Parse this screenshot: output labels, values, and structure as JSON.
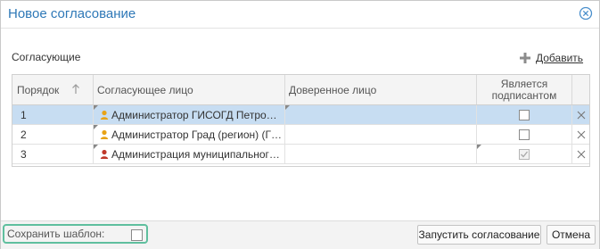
{
  "dialog": {
    "title": "Новое согласование"
  },
  "section": {
    "label": "Согласующие",
    "add_label": "Добавить"
  },
  "table": {
    "columns": {
      "order": "Порядок",
      "person": "Согласующее лицо",
      "trusted": "Доверенное лицо",
      "signer_line1": "Является",
      "signer_line2": "подписантом"
    },
    "rows": [
      {
        "order": "1",
        "person": "Администратор ГИСОГД Петро…",
        "trusted": "",
        "signer": false,
        "selected": true,
        "icon": "user-gold-icon"
      },
      {
        "order": "2",
        "person": "Администратор Град (регион) (Г…",
        "trusted": "",
        "signer": false,
        "selected": false,
        "icon": "user-gold-icon"
      },
      {
        "order": "3",
        "person": "Администрация муниципальног…",
        "trusted": "",
        "signer": true,
        "selected": false,
        "icon": "user-red-icon"
      }
    ]
  },
  "footer": {
    "save_template_label": "Сохранить шаблон:",
    "start_button": "Запустить согласование",
    "cancel_button": "Отмена"
  },
  "colors": {
    "title": "#2e78b7",
    "selected_row": "#c7ddf2",
    "template_border": "#5fbf9e",
    "user_gold": "#e8a317",
    "user_red": "#c0392b"
  }
}
